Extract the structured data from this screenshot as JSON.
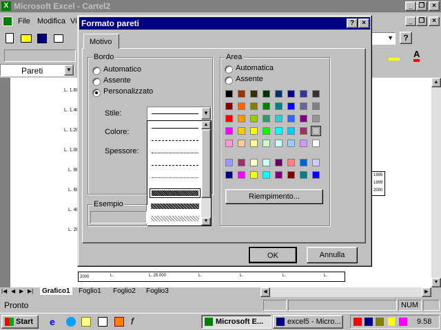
{
  "app": {
    "title": "Microsoft Excel - Cartel2",
    "menu": [
      "File",
      "Modifica",
      "Vi"
    ],
    "name_box": "Pareti",
    "sheet_tabs": [
      "Grafico1",
      "Foglio1",
      "Foglio2",
      "Foglio3"
    ],
    "status": "Pronto",
    "num_indicator": "NUM",
    "chart_ylabels": [
      "L. 1.60",
      "L. 1.40",
      "L. 1.20",
      "L. 1.00",
      "L. 80",
      "L. 60",
      "L. 40",
      "L. 20"
    ],
    "legend_labels": [
      "1995",
      "1999",
      "2000"
    ],
    "table_row_label": "2000",
    "table_cells": [
      "L.",
      "L. 25.000",
      "L.",
      "L.",
      "L.",
      "L."
    ]
  },
  "dialog": {
    "title": "Formato pareti",
    "tab": "Motivo",
    "border_group": "Bordo",
    "border_options": [
      "Automatico",
      "Assente",
      "Personalizzato"
    ],
    "style_label": "Stile:",
    "color_label": "Colore:",
    "weight_label": "Spessore:",
    "sample_group": "Esempio",
    "area_group": "Area",
    "area_options": [
      "Automatica",
      "Assente"
    ],
    "fill_button": "Riempimento...",
    "ok_button": "OK",
    "cancel_button": "Annulla",
    "palette_rows": [
      [
        "#000000",
        "#993300",
        "#333300",
        "#003300",
        "#003366",
        "#000080",
        "#333399",
        "#333333"
      ],
      [
        "#800000",
        "#FF6600",
        "#808000",
        "#008000",
        "#008080",
        "#0000FF",
        "#666699",
        "#808080"
      ],
      [
        "#FF0000",
        "#FF9900",
        "#99CC00",
        "#339966",
        "#33CCCC",
        "#3366FF",
        "#800080",
        "#969696"
      ],
      [
        "#FF00FF",
        "#FFCC00",
        "#FFFF00",
        "#00FF00",
        "#00FFFF",
        "#00CCFF",
        "#993366",
        "#C0C0C0"
      ],
      [
        "#FF99CC",
        "#FFCC99",
        "#FFFF99",
        "#CCFFCC",
        "#CCFFFF",
        "#99CCFF",
        "#CC99FF",
        "#FFFFFF"
      ],
      [
        "#9999FF",
        "#993366",
        "#FFFFCC",
        "#CCFFFF",
        "#660066",
        "#FF8080",
        "#0066CC",
        "#CCCCFF"
      ],
      [
        "#000080",
        "#FF00FF",
        "#FFFF00",
        "#00FFFF",
        "#800080",
        "#800000",
        "#008080",
        "#0000FF"
      ]
    ]
  },
  "taskbar": {
    "start": "Start",
    "tasks": [
      "Microsoft E...",
      "excel5 - Micro..."
    ],
    "clock": "9.58"
  }
}
